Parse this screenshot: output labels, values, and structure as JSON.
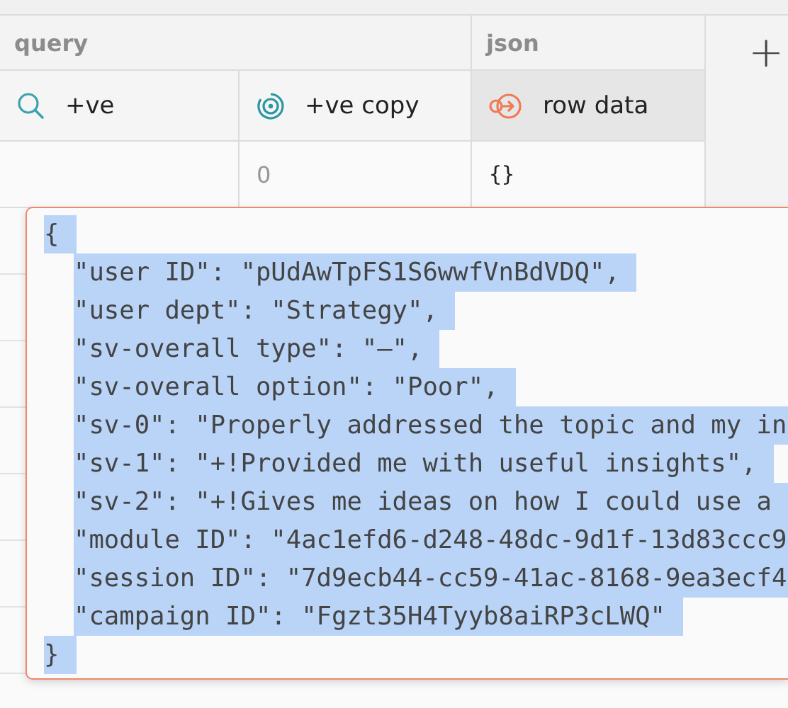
{
  "column_groups": [
    {
      "label": "query"
    },
    {
      "label": "json"
    }
  ],
  "columns": [
    {
      "label": "+ve",
      "kind": "query",
      "selected": false
    },
    {
      "label": "+ve copy",
      "kind": "query-copy",
      "selected": false
    },
    {
      "label": "row data",
      "kind": "json",
      "selected": true
    }
  ],
  "add_column": {
    "label": "+"
  },
  "rows": [
    {
      "cells": [
        {
          "kind": "empty"
        },
        {
          "kind": "number",
          "text": "0"
        },
        {
          "kind": "json",
          "text": "{}"
        }
      ]
    }
  ],
  "popup": {
    "selected": true,
    "open": "{",
    "close": "}",
    "entries": [
      "\"user ID\": \"pUdAwTpFS1S6wwfVnBdVDQ\",",
      "\"user dept\": \"Strategy\",",
      "\"sv-overall type\": \"–\",",
      "\"sv-overall option\": \"Poor\",",
      "\"sv-0\": \"Properly addressed the topic and my in",
      "\"sv-1\": \"+!Provided me with useful insights\",",
      "\"sv-2\": \"+!Gives me ideas on how I could use a",
      "\"module ID\": \"4ac1efd6-d248-48dc-9d1f-13d83ccc9",
      "\"session ID\": \"7d9ecb44-cc59-41ac-8168-9ea3ecf4",
      "\"campaign ID\": \"Fgzt35H4Tyyb8aiRP3cLWQ\""
    ]
  }
}
